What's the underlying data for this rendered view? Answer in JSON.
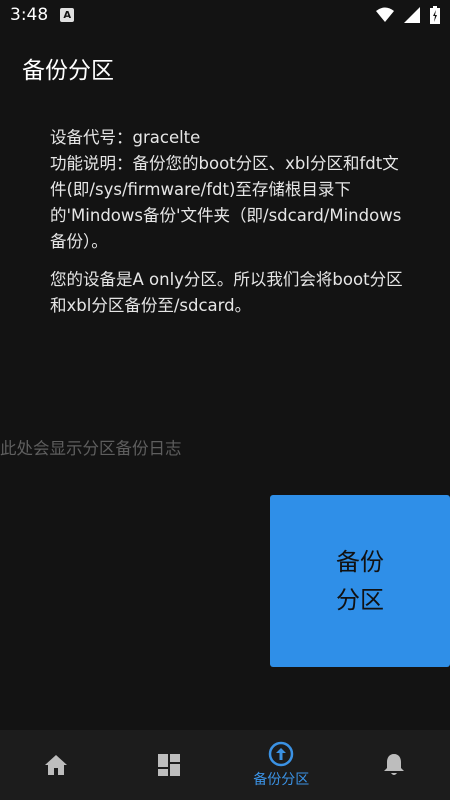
{
  "status_bar": {
    "time": "3:48",
    "app_icon_letter": "A"
  },
  "app_bar": {
    "title": "备份分区"
  },
  "info": {
    "device_line": "设备代号：gracelte",
    "description": "功能说明：备份您的boot分区、xbl分区和fdt文件(即/sys/firmware/fdt)至存储根目录下的'Mindows备份'文件夹（即/sdcard/Mindows备份）。",
    "partition_info": "您的设备是A only分区。所以我们会将boot分区和xbl分区备份至/sdcard。"
  },
  "log": {
    "placeholder": "此处会显示分区备份日志"
  },
  "backup_button": {
    "line1": "备份",
    "line2": "分区"
  },
  "bottom_nav": {
    "items": [
      {
        "icon": "home-icon",
        "label": ""
      },
      {
        "icon": "dashboard-icon",
        "label": ""
      },
      {
        "icon": "upload-icon",
        "label": "备份分区"
      },
      {
        "icon": "bell-icon",
        "label": ""
      }
    ]
  },
  "colors": {
    "background": "#131313",
    "accent": "#2f8fe8",
    "nav_active": "#3b92e4"
  }
}
